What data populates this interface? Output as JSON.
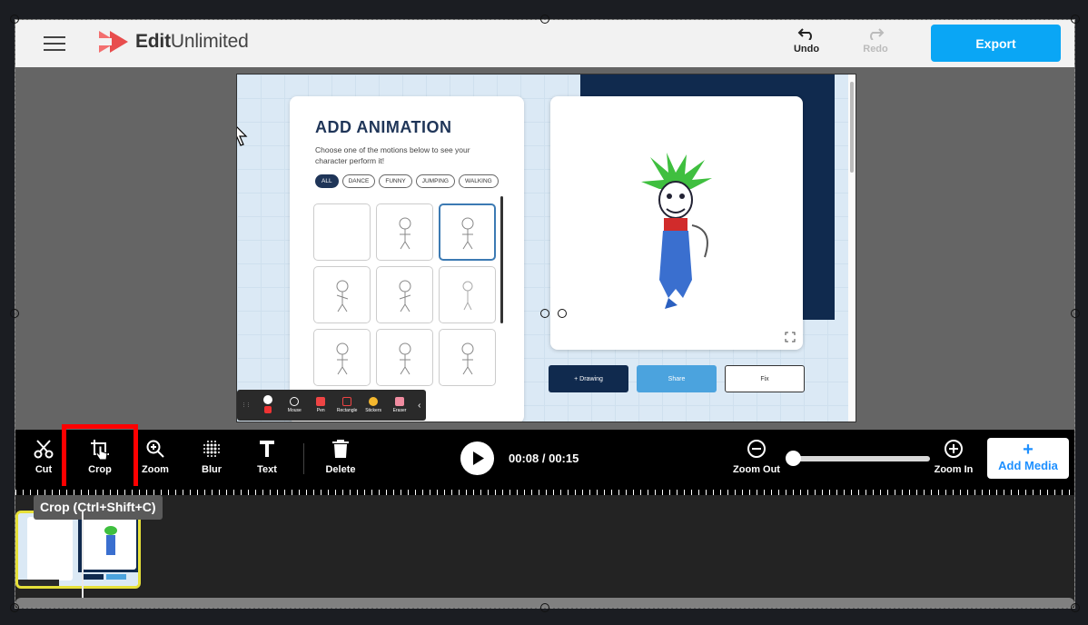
{
  "app": {
    "brand_prefix": "Edit",
    "brand_suffix": "Unlimited",
    "undo_label": "Undo",
    "redo_label": "Redo",
    "export_label": "Export"
  },
  "preview": {
    "anim_title": "ADD ANIMATION",
    "anim_desc": "Choose one of the motions below to see your character perform it!",
    "chips": [
      "ALL",
      "DANCE",
      "FUNNY",
      "JUMPING",
      "WALKING"
    ],
    "btn_drawing": "+ Drawing",
    "btn_share": "Share",
    "btn_fix": "Fix",
    "rec_tools": [
      "Mouse",
      "Pen",
      "Rectangle",
      "Stickers",
      "Eraser"
    ]
  },
  "toolbar": {
    "cut": "Cut",
    "crop": "Crop",
    "zoom": "Zoom",
    "blur": "Blur",
    "text": "Text",
    "delete": "Delete",
    "time": "00:08 / 00:15",
    "zoom_out": "Zoom Out",
    "zoom_in": "Zoom In",
    "add_media": "Add Media",
    "add_media_plus": "+"
  },
  "timeline": {
    "tooltip": "Crop (Ctrl+Shift+C)"
  },
  "colors": {
    "accent": "#0aa6f5",
    "highlight": "#ff0000",
    "clip_border": "#e6e03a"
  }
}
